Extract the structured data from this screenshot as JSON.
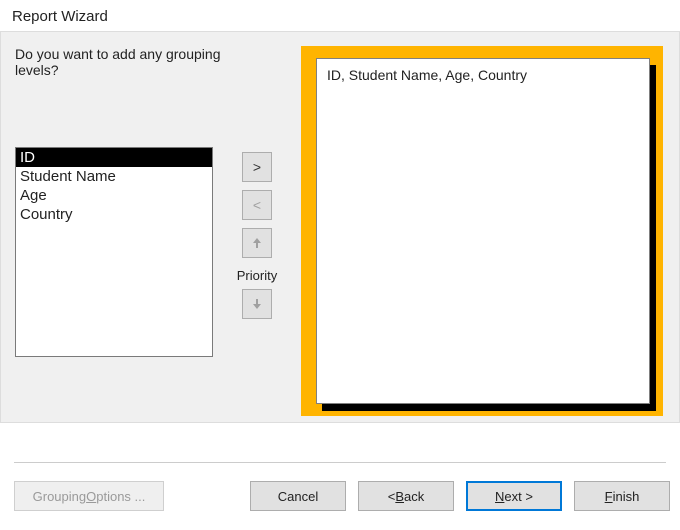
{
  "window": {
    "title": "Report Wizard"
  },
  "prompt": "Do you want to add any grouping levels?",
  "fields": {
    "items": [
      "ID",
      "Student Name",
      "Age",
      "Country"
    ],
    "selected_index": 0
  },
  "controls": {
    "add": ">",
    "remove": "<",
    "priority_label": "Priority"
  },
  "preview": {
    "line": "ID, Student Name, Age, Country"
  },
  "footer": {
    "grouping_options": "Grouping Options ...",
    "cancel": "Cancel",
    "back_prefix": "< ",
    "back_key": "B",
    "back_suffix": "ack",
    "next_key": "N",
    "next_suffix": "ext >",
    "finish_key": "F",
    "finish_suffix": "inish",
    "grouping_prefix": "Grouping ",
    "grouping_key": "O",
    "grouping_suffix": "ptions ..."
  }
}
